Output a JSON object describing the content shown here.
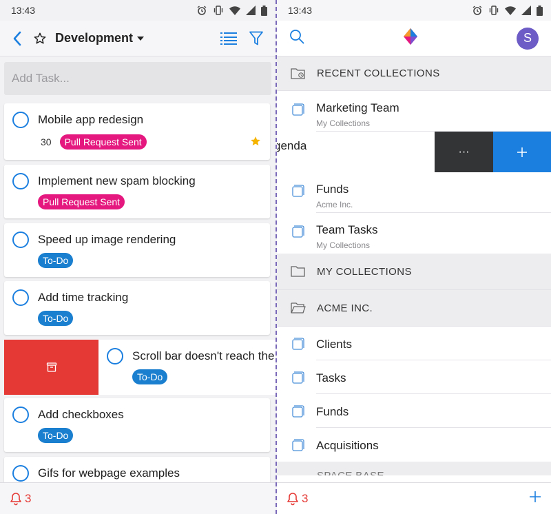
{
  "status": {
    "time": "13:43"
  },
  "left": {
    "header": {
      "title": "Development"
    },
    "add_task": {
      "placeholder": "Add Task..."
    },
    "tasks": [
      {
        "title": "Mobile app redesign",
        "count": "30",
        "tag": "Pull Request Sent",
        "starred": true
      },
      {
        "title": "Implement new spam blocking",
        "tag": "Pull Request Sent"
      },
      {
        "title": "Speed up image rendering",
        "tag": "To-Do"
      },
      {
        "title": "Add time tracking",
        "tag": "To-Do"
      },
      {
        "title": "Scroll bar doesn't reach the",
        "tag": "To-Do"
      },
      {
        "title": "Add checkboxes",
        "tag": "To-Do"
      },
      {
        "title": "Gifs for webpage examples"
      }
    ],
    "bottom": {
      "notifications": "3"
    }
  },
  "right": {
    "avatar": "S",
    "recent_header": "RECENT COLLECTIONS",
    "recent": [
      {
        "name": "Marketing Team",
        "sub": "My Collections"
      },
      {
        "name": "genda"
      },
      {
        "name": "Funds",
        "sub": "Acme Inc."
      },
      {
        "name": "Team Tasks",
        "sub": "My Collections"
      }
    ],
    "swipe_more": "···",
    "my_collections_header": "MY COLLECTIONS",
    "acme_header": "ACME INC.",
    "acme": [
      {
        "name": "Clients"
      },
      {
        "name": "Tasks"
      },
      {
        "name": "Funds"
      },
      {
        "name": "Acquisitions"
      }
    ],
    "next_header": "SPACE BASE",
    "bottom": {
      "notifications": "3"
    }
  },
  "colors": {
    "accent": "#1b7fe0",
    "pink_tag": "#e5187f",
    "blue_tag": "#1b7fcf",
    "archive": "#e53935",
    "avatar": "#6d5bc6"
  }
}
